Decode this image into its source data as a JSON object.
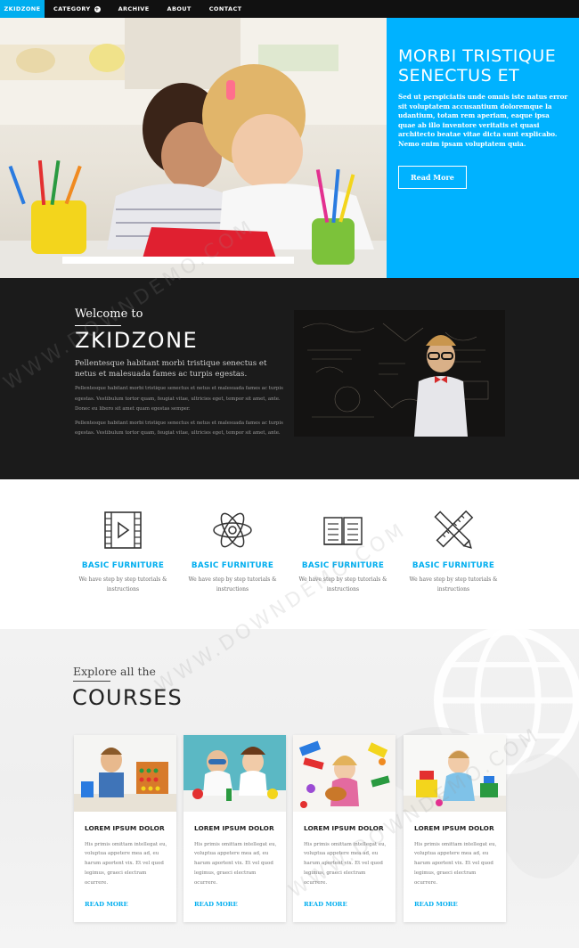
{
  "nav": {
    "brand": "ZKIDZONE",
    "items": [
      {
        "label": "CATEGORY",
        "has_dropdown": true
      },
      {
        "label": "ARCHIVE"
      },
      {
        "label": "ABOUT"
      },
      {
        "label": "CONTACT"
      }
    ],
    "dropdown_glyph": "+"
  },
  "hero": {
    "title": "MORBI TRISTIQUE SENECTUS ET",
    "text": "Sed ut perspiciatis unde omnis iste natus error sit voluptatem accusantium doloremque la udantium, totam rem aperiam, eaque ipsa quae ab illo inventore veritatis et quasi architecto beatae vitae dicta sunt explicabo. Nemo enim ipsam voluptatem quia.",
    "button": "Read More",
    "panel_color": "#00b2ff"
  },
  "welcome": {
    "kicker": "Welcome to",
    "brand": "ZKIDZONE",
    "lead": "Pellentesque habitant morbi tristique senectus et netus et malesuada fames ac turpis egestas.",
    "body1": "Pellentesque habitant morbi tristique senectus et netus et malesuada fames ac turpis egestas. Vestibulum tortor quam, feugiat vitae, ultricies eget, tempor sit amet, ante. Donec eu libero sit amet quam egestas semper.",
    "body2": "Pellentesque habitant morbi tristique senectus et netus et malesuada fames ac turpis egestas. Vestibulum tortor quam, feugiat vitae, ultricies eget, tempor sit amet, ante."
  },
  "features": [
    {
      "icon": "film-icon",
      "title": "BASIC FURNITURE",
      "text": "We have step by step tutorials & instructions"
    },
    {
      "icon": "atom-icon",
      "title": "BASIC FURNITURE",
      "text": "We have step by step tutorials & instructions"
    },
    {
      "icon": "book-icon",
      "title": "BASIC FURNITURE",
      "text": "We have step by step tutorials & instructions"
    },
    {
      "icon": "pencil-ruler-icon",
      "title": "BASIC FURNITURE",
      "text": "We have step by step tutorials & instructions"
    }
  ],
  "courses": {
    "kicker": "Explore all the",
    "title": "COURSES",
    "cards": [
      {
        "title": "LOREM IPSUM DOLOR",
        "text": "His primis omittam intellegat eu, voluptua appetere mea ad, eu harum aportent vix. Et vel quod legimus, graeci electram ocurrere.",
        "more": "READ MORE"
      },
      {
        "title": "LOREM IPSUM DOLOR",
        "text": "His primis omittam intellegat eu, voluptua appetere mea ad, eu harum aportent vix. Et vel quod legimus, graeci electram ocurrere.",
        "more": "READ MORE"
      },
      {
        "title": "LOREM IPSUM DOLOR",
        "text": "His primis omittam intellegat eu, voluptua appetere mea ad, eu harum aportent vix. Et vel quod legimus, graeci electram ocurrere.",
        "more": "READ MORE"
      },
      {
        "title": "LOREM IPSUM DOLOR",
        "text": "His primis omittam intellegat eu, voluptua appetere mea ad, eu harum aportent vix. Et vel quod legimus, graeci electram ocurrere.",
        "more": "READ MORE"
      }
    ]
  },
  "watermark": "WWW.DOWNDEMO.COM",
  "colors": {
    "accent": "#00aeef",
    "nav_bg": "#111111",
    "dark_section": "#1b1b1b"
  }
}
